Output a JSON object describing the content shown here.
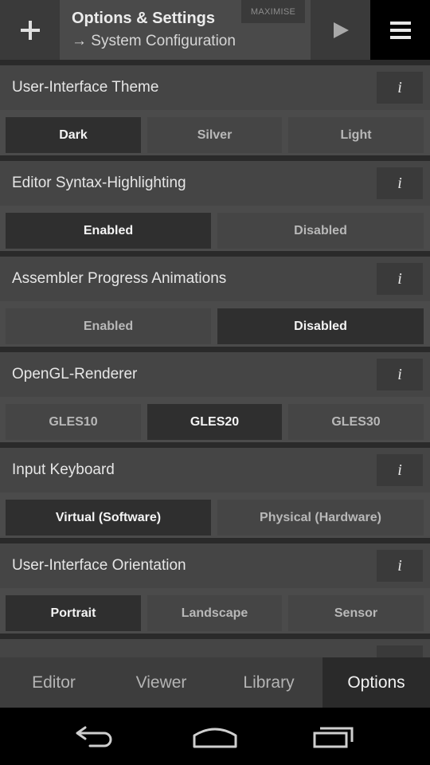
{
  "topbar": {
    "title": "Options & Settings",
    "subtitle": "→ System Configuration",
    "maximise_label": "MAXIMISE",
    "add_icon": "plus-icon",
    "play_icon": "play-icon",
    "menu_icon": "hamburger-menu-icon"
  },
  "settings": [
    {
      "label": "User-Interface Theme",
      "info": "i",
      "options": [
        "Dark",
        "Silver",
        "Light"
      ],
      "selected": "Dark"
    },
    {
      "label": "Editor Syntax-Highlighting",
      "info": "i",
      "options": [
        "Enabled",
        "Disabled"
      ],
      "selected": "Enabled"
    },
    {
      "label": "Assembler Progress Animations",
      "info": "i",
      "options": [
        "Enabled",
        "Disabled"
      ],
      "selected": "Disabled"
    },
    {
      "label": "OpenGL-Renderer",
      "info": "i",
      "options": [
        "GLES10",
        "GLES20",
        "GLES30"
      ],
      "selected": "GLES20"
    },
    {
      "label": "Input Keyboard",
      "info": "i",
      "options": [
        "Virtual (Software)",
        "Physical (Hardware)"
      ],
      "selected": "Virtual (Software)"
    },
    {
      "label": "User-Interface Orientation",
      "info": "i",
      "options": [
        "Portrait",
        "Landscape",
        "Sensor"
      ],
      "selected": "Portrait"
    }
  ],
  "tabs": [
    {
      "label": "Editor",
      "active": false
    },
    {
      "label": "Viewer",
      "active": false
    },
    {
      "label": "Library",
      "active": false
    },
    {
      "label": "Options",
      "active": true
    }
  ],
  "navbar": {
    "back_icon": "back-icon",
    "home_icon": "home-icon",
    "recents_icon": "recent-apps-icon"
  },
  "colors": {
    "background": "#2a2a2a",
    "header": "#454545",
    "selected_option": "#2f2f2f",
    "unselected_option": "#454545"
  }
}
